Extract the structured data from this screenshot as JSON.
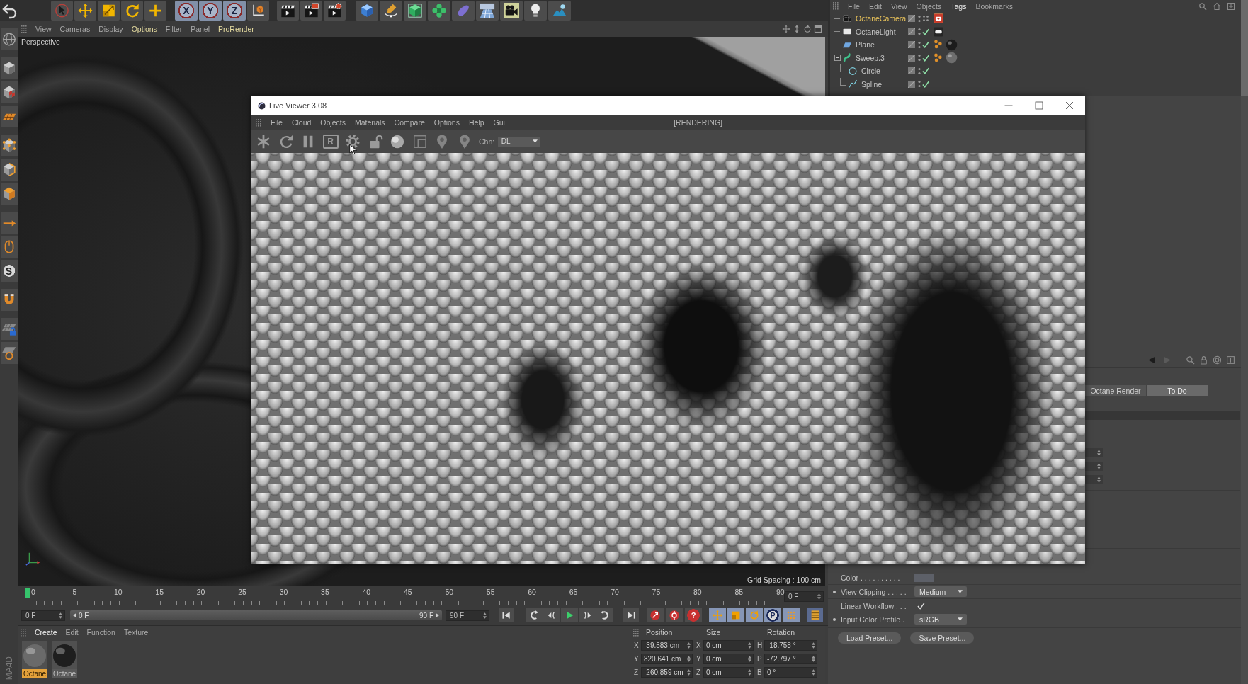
{
  "main_toolbar": {
    "axis_buttons": [
      "X",
      "Y",
      "Z"
    ]
  },
  "object_manager": {
    "menu": [
      {
        "label": "File",
        "highlighted": false
      },
      {
        "label": "Edit",
        "highlighted": false
      },
      {
        "label": "View",
        "highlighted": false
      },
      {
        "label": "Objects",
        "highlighted": false
      },
      {
        "label": "Tags",
        "highlighted": true
      },
      {
        "label": "Bookmarks",
        "highlighted": false
      }
    ],
    "objects": [
      {
        "name": "OctaneCamera",
        "kind": "camera",
        "selected": true,
        "checked": false,
        "tags": [
          {
            "kind": "camera"
          }
        ]
      },
      {
        "name": "OctaneLight",
        "kind": "light",
        "selected": false,
        "checked": true,
        "tags": [
          {
            "kind": "light"
          }
        ]
      },
      {
        "name": "Plane",
        "kind": "plane",
        "selected": false,
        "checked": true,
        "tags": [
          {
            "kind": "texture"
          },
          {
            "kind": "material",
            "color": "#1c1c1c"
          }
        ]
      },
      {
        "name": "Sweep.3",
        "kind": "sweep",
        "selected": false,
        "checked": true,
        "expanded": true,
        "tags": [
          {
            "kind": "texture"
          },
          {
            "kind": "material",
            "color": "#6e6e6e"
          }
        ],
        "children": [
          {
            "name": "Circle",
            "kind": "circle",
            "selected": false,
            "checked": true
          },
          {
            "name": "Spline",
            "kind": "spline",
            "selected": false,
            "checked": true
          }
        ]
      }
    ]
  },
  "tool_palette": {
    "snap_glyph": "S",
    "brand": "MA4D"
  },
  "viewport": {
    "menu": [
      {
        "label": "View",
        "highlighted": false
      },
      {
        "label": "Cameras",
        "highlighted": false
      },
      {
        "label": "Display",
        "highlighted": false
      },
      {
        "label": "Options",
        "highlighted": true
      },
      {
        "label": "Filter",
        "highlighted": false
      },
      {
        "label": "Panel",
        "highlighted": false
      },
      {
        "label": "ProRender",
        "highlighted": true
      }
    ],
    "camera_label": "Perspective",
    "grid_spacing": "Grid Spacing : 100 cm"
  },
  "live_viewer": {
    "title": "Live Viewer 3.08",
    "menu": [
      "File",
      "Cloud",
      "Objects",
      "Materials",
      "Compare",
      "Options",
      "Help",
      "Gui"
    ],
    "status": "[RENDERING]",
    "region_glyph": "R",
    "channel": {
      "label": "Chn:",
      "value": "DL"
    }
  },
  "attributes": {
    "tabs": [
      {
        "label": "Octane Render",
        "selected": false
      },
      {
        "label": "To Do",
        "selected": true
      }
    ],
    "fields": [
      {
        "kind": "color",
        "label": "Color . . . . . . . . . .",
        "color": "#5d6068",
        "keyframe": false
      },
      {
        "kind": "dropdown",
        "label": "View Clipping . . . . .",
        "value": "Medium",
        "keyframe": true
      },
      {
        "kind": "checkbox",
        "label": "Linear Workflow . . .",
        "checked": true,
        "keyframe": false
      },
      {
        "kind": "dropdown",
        "label": "Input Color Profile .",
        "value": "sRGB",
        "keyframe": true
      }
    ],
    "buttons": [
      "Load Preset...",
      "Save Preset..."
    ]
  },
  "timeline": {
    "frame_labels": [
      "0",
      "5",
      "10",
      "15",
      "20",
      "25",
      "30",
      "35",
      "40",
      "45",
      "50",
      "55",
      "60",
      "65",
      "70",
      "75",
      "80",
      "85",
      "90"
    ],
    "playhead": {
      "level": 0
    },
    "current_frame": "0 F"
  },
  "transport": {
    "start_frame": "0 F",
    "range_start": "0 F",
    "range_end": "90 F",
    "end_frame": "90 F",
    "keyframe_glyph": "?",
    "parameter_glyph": "P"
  },
  "material_manager": {
    "menu": [
      {
        "label": "Create",
        "highlighted": true
      },
      {
        "label": "Edit",
        "highlighted": false
      },
      {
        "label": "Function",
        "highlighted": false
      },
      {
        "label": "Texture",
        "highlighted": false
      }
    ],
    "materials": [
      {
        "name": "Octane",
        "selected": true,
        "color": "#6a6a6a"
      },
      {
        "name": "Octane",
        "selected": false,
        "color": "#1e1e1e"
      }
    ]
  },
  "coordinates": {
    "headers": [
      "Position",
      "Size",
      "Rotation"
    ],
    "rows": [
      {
        "cells": [
          {
            "axis": "X",
            "value": "-39.583 cm"
          },
          {
            "axis": "X",
            "value": "0 cm"
          },
          {
            "axis": "H",
            "value": "-18.758 °"
          }
        ]
      },
      {
        "cells": [
          {
            "axis": "Y",
            "value": "820.641 cm"
          },
          {
            "axis": "Y",
            "value": "0 cm"
          },
          {
            "axis": "P",
            "value": "-72.797 °"
          }
        ]
      },
      {
        "cells": [
          {
            "axis": "Z",
            "value": "-260.859 cm"
          },
          {
            "axis": "Z",
            "value": "0 cm"
          },
          {
            "axis": "B",
            "value": "0 °"
          }
        ]
      }
    ]
  }
}
